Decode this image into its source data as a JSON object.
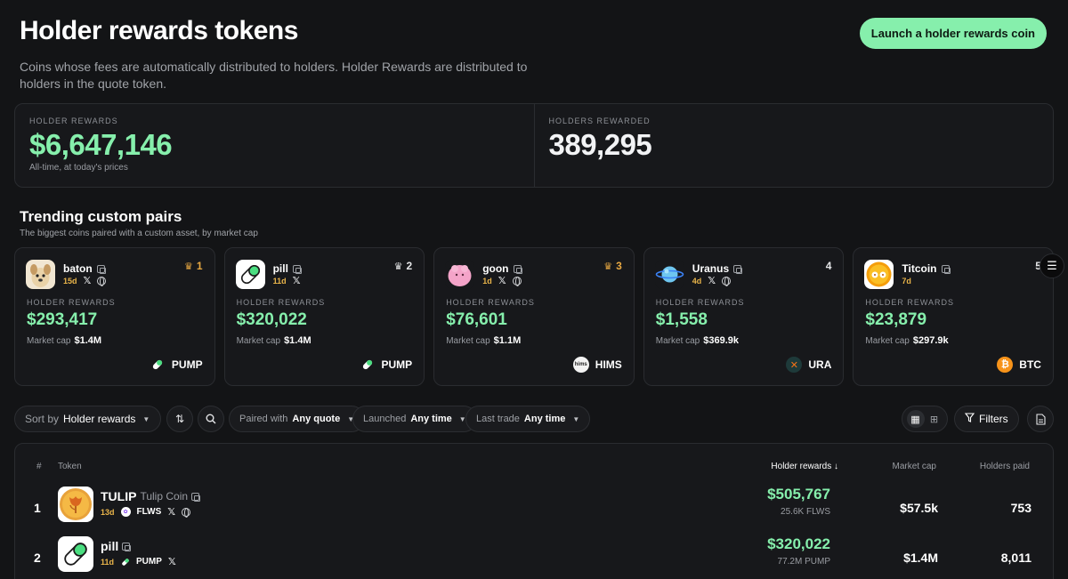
{
  "header": {
    "title": "Holder rewards tokens",
    "subtitle": "Coins whose fees are automatically distributed to holders. Holder Rewards are distributed to holders in the quote token.",
    "launch_button": "Launch a holder rewards coin"
  },
  "stats": {
    "holder_rewards": {
      "label": "HOLDER REWARDS",
      "value": "$6,647,146",
      "note": "All-time, at today's prices"
    },
    "holders_rewarded": {
      "label": "HOLDERS REWARDED",
      "value": "389,295"
    }
  },
  "trending": {
    "title": "Trending custom pairs",
    "subtitle": "The biggest coins paired with a custom asset, by market cap",
    "rewards_label": "HOLDER REWARDS",
    "mcap_label": "Market cap",
    "cards": [
      {
        "name": "baton",
        "age": "15d",
        "rank": "1",
        "rewards": "$293,417",
        "mcap": "$1.4M",
        "quote": "PUMP",
        "avatar_icon": "dog-avatar-icon",
        "quote_icon": "pill-icon",
        "has_web": true
      },
      {
        "name": "pill",
        "age": "11d",
        "rank": "2",
        "rewards": "$320,022",
        "mcap": "$1.4M",
        "quote": "PUMP",
        "avatar_icon": "pill-avatar-icon",
        "quote_icon": "pill-icon",
        "has_web": false
      },
      {
        "name": "goon",
        "age": "1d",
        "rank": "3",
        "rewards": "$76,601",
        "mcap": "$1.1M",
        "quote": "HIMS",
        "avatar_icon": "pink-blob-avatar-icon",
        "quote_icon": "hims-icon",
        "quote_icon_text": "hims",
        "has_web": true
      },
      {
        "name": "Uranus",
        "age": "4d",
        "rank": "4",
        "rewards": "$1,558",
        "mcap": "$369.9k",
        "quote": "URA",
        "avatar_icon": "planet-avatar-icon",
        "quote_icon": "ura-icon",
        "has_web": true
      },
      {
        "name": "Titcoin",
        "age": "7d",
        "rank": "5",
        "rewards": "$23,879",
        "mcap": "$297.9k",
        "quote": "BTC",
        "avatar_icon": "titcoin-avatar-icon",
        "quote_icon": "bitcoin-icon",
        "has_web": false
      }
    ]
  },
  "filters": {
    "sort_prefix": "Sort by",
    "sort_value": "Holder rewards",
    "paired_label": "Paired with",
    "paired_value": "Any quote",
    "launched_label": "Launched",
    "launched_value": "Any time",
    "last_trade_label": "Last trade",
    "last_trade_value": "Any time",
    "filters_label": "Filters"
  },
  "table": {
    "headers": {
      "rank": "#",
      "token": "Token",
      "rewards": "Holder rewards ↓",
      "mcap": "Market cap",
      "holders": "Holders paid"
    },
    "rows": [
      {
        "rank": "1",
        "ticker": "TULIP",
        "name": "Tulip Coin",
        "age": "13d",
        "quote": "FLWS",
        "rewards": "$505,767",
        "rewards_sub": "25.6K FLWS",
        "mcap": "$57.5k",
        "holders": "753"
      },
      {
        "rank": "2",
        "ticker": "pill",
        "name": "",
        "age": "11d",
        "quote": "PUMP",
        "rewards": "$320,022",
        "rewards_sub": "77.2M PUMP",
        "mcap": "$1.4M",
        "holders": "8,011"
      }
    ]
  },
  "colors": {
    "background": "#131416",
    "accent_green": "#86efac",
    "age_gold": "#eab54a",
    "rank_gold": "#e8a842"
  }
}
